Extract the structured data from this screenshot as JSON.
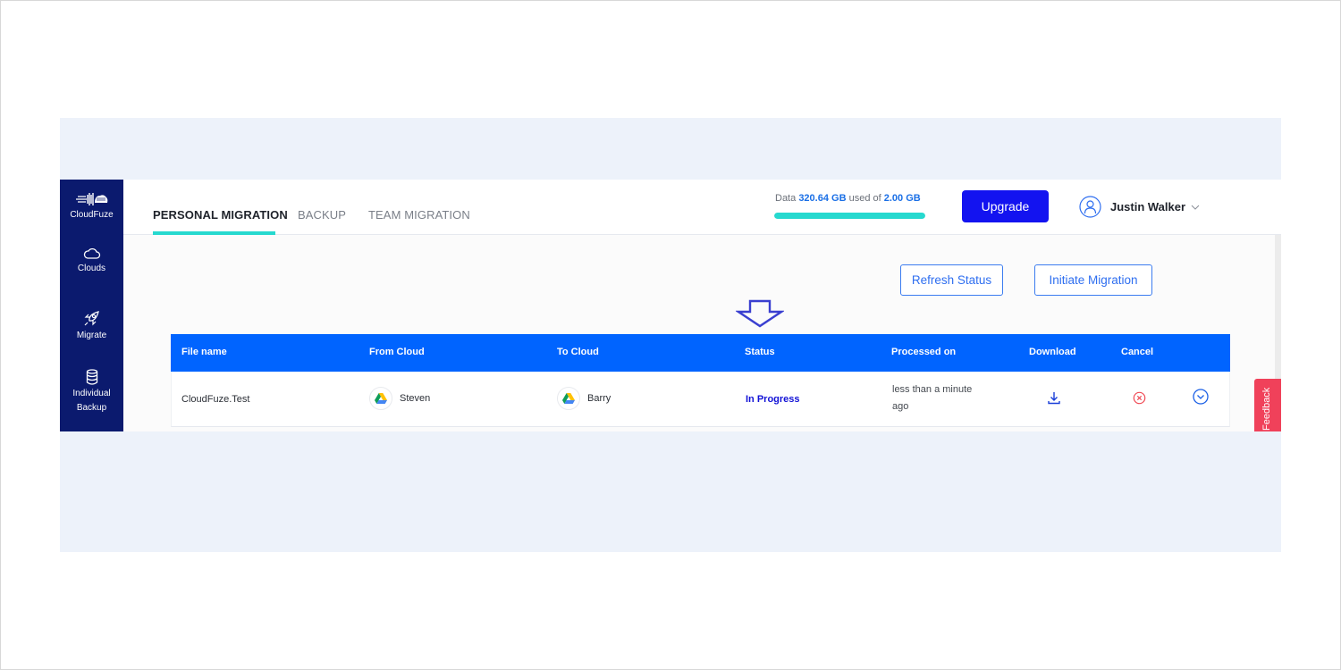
{
  "sidebar": {
    "brand": "CloudFuze",
    "items": [
      {
        "label": "Clouds",
        "icon": "cloud-icon"
      },
      {
        "label": "Migrate",
        "icon": "rocket-icon"
      },
      {
        "label": "Individual",
        "label2": "Backup",
        "icon": "database-icon"
      }
    ]
  },
  "header": {
    "tabs": [
      {
        "label": "PERSONAL MIGRATION",
        "active": true
      },
      {
        "label": "BACKUP",
        "active": false
      },
      {
        "label": "TEAM MIGRATION",
        "active": false
      }
    ],
    "usage": {
      "prefix": "Data",
      "used": "320.64 GB",
      "middle": "used of",
      "total": "2.00 GB",
      "fill_percent": 100
    },
    "upgrade_label": "Upgrade",
    "user_name": "Justin Walker"
  },
  "actions": {
    "refresh_label": "Refresh Status",
    "initiate_label": "Initiate Migration"
  },
  "table": {
    "columns": [
      "File name",
      "From Cloud",
      "To Cloud",
      "Status",
      "Processed on",
      "Download",
      "Cancel"
    ],
    "rows": [
      {
        "file_name": "CloudFuze.Test",
        "from_cloud": "Steven",
        "to_cloud": "Barry",
        "status": "In Progress",
        "processed_line1": "less than a minute",
        "processed_line2": "ago"
      }
    ]
  },
  "colors": {
    "sidebar": "#0b1a6e",
    "header_row": "#0064ff",
    "accent": "#26d9cf",
    "upgrade": "#1313f0",
    "feedback": "#f0415a"
  },
  "feedback_label": "Feedback"
}
